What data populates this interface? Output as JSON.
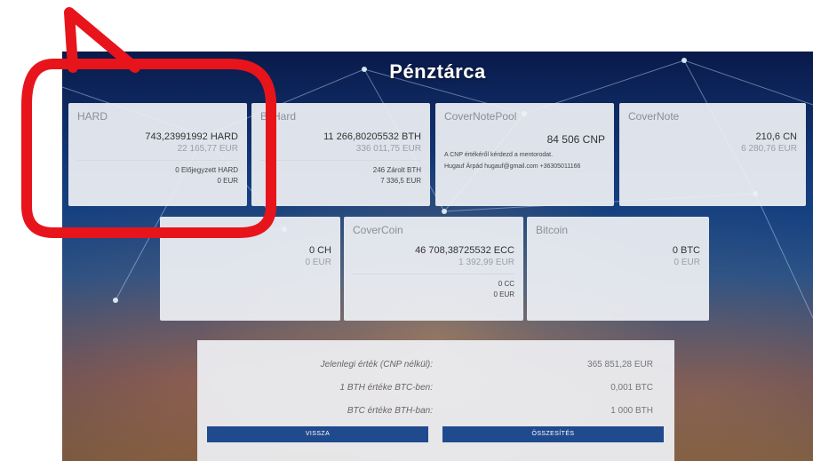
{
  "page": {
    "title": "Pénztárca"
  },
  "wallets_row1": [
    {
      "title": "HARD",
      "amount": "743,23991992 HARD",
      "eur": "22 165,77 EUR",
      "extra": [
        "0 Előjegyzett HARD",
        "0 EUR"
      ]
    },
    {
      "title": "BitHard",
      "amount": "11 266,80205532 BTH",
      "eur": "336 011,75 EUR",
      "extra": [
        "246 Zárolt BTH",
        "7 336,5 EUR"
      ]
    },
    {
      "title": "CoverNotePool",
      "amount": "84 506 CNP",
      "note": [
        "A CNP értékéről kérdezd a mentorodat.",
        "Hugauf Árpád hugauf@gmail.com +36305011166"
      ]
    },
    {
      "title": "CoverNote",
      "amount": "210,6 CN",
      "eur": "6 280,76 EUR"
    }
  ],
  "wallets_row2": [
    {
      "title": "",
      "amount": "0 CH",
      "eur": "0 EUR"
    },
    {
      "title": "CoverCoin",
      "amount": "46 708,38725532 ECC",
      "eur": "1 392,99 EUR",
      "extra": [
        "0 CC",
        "0 EUR"
      ]
    },
    {
      "title": "Bitcoin",
      "amount": "0 BTC",
      "eur": "0 EUR"
    }
  ],
  "summary": {
    "rows": [
      {
        "label": "Jelenlegi érték (CNP nélkül):",
        "value": "365 851,28 EUR"
      },
      {
        "label": "1 BTH értéke BTC-ben:",
        "value": "0,001 BTC"
      },
      {
        "label": "BTC értéke BTH-ban:",
        "value": "1 000 BTH"
      }
    ],
    "back_label": "VISSZA",
    "total_label": "ÖSSZESÍTÉS"
  },
  "colors": {
    "button": "#1f4a8e",
    "callout": "#e8141b"
  }
}
